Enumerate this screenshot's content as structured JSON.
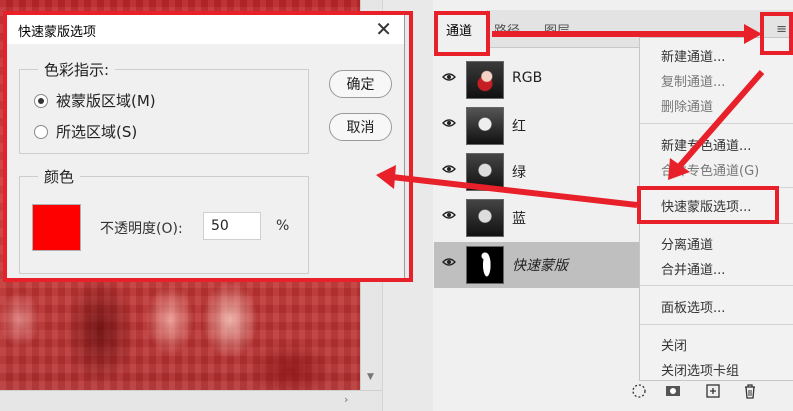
{
  "dialog": {
    "title": "快速蒙版选项",
    "color_indicates": {
      "legend": "色彩指示:",
      "options": [
        {
          "label": "被蒙版区域(M)",
          "checked": true
        },
        {
          "label": "所选区域(S)",
          "checked": false
        }
      ]
    },
    "color": {
      "legend": "颜色",
      "swatch_color": "#ff0000",
      "opacity_label": "不透明度(O):",
      "opacity_value": "50",
      "opacity_unit": "%"
    },
    "buttons": {
      "ok": "确定",
      "cancel": "取消"
    }
  },
  "panel": {
    "tabs": [
      "通道",
      "路径",
      "图层"
    ],
    "channels": [
      {
        "name": "RGB",
        "selected": false,
        "italic": false
      },
      {
        "name": "红",
        "selected": false,
        "italic": false
      },
      {
        "name": "绿",
        "selected": false,
        "italic": false
      },
      {
        "name": "蓝",
        "selected": false,
        "italic": false
      },
      {
        "name": "快速蒙版",
        "selected": true,
        "italic": true
      }
    ],
    "menu_icon": "hamburger-menu-icon",
    "bottom_icons": [
      "load-selection-icon",
      "save-selection-icon",
      "new-channel-icon",
      "trash-icon"
    ]
  },
  "flyout_menu": {
    "items": [
      {
        "label": "新建通道...",
        "enabled": true
      },
      {
        "label": "复制通道...",
        "enabled": false
      },
      {
        "label": "删除通道",
        "enabled": false
      },
      {
        "label": "新建专色通道...",
        "enabled": true
      },
      {
        "label": "合并专色通道(G)",
        "enabled": false
      },
      {
        "label": "快速蒙版选项...",
        "enabled": true
      },
      {
        "label": "分离通道",
        "enabled": true
      },
      {
        "label": "合并通道...",
        "enabled": true
      },
      {
        "label": "面板选项...",
        "enabled": true
      },
      {
        "label": "关闭",
        "enabled": true
      },
      {
        "label": "关闭选项卡组",
        "enabled": true
      }
    ]
  },
  "annotation_color": "#e8202a"
}
